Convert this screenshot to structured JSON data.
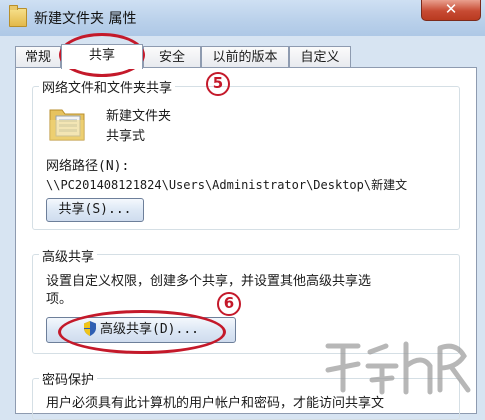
{
  "window": {
    "title": "新建文件夹 属性",
    "close_label": "✕"
  },
  "tabs": [
    {
      "label": "常规"
    },
    {
      "label": "共享"
    },
    {
      "label": "安全"
    },
    {
      "label": "以前的版本"
    },
    {
      "label": "自定义"
    }
  ],
  "network_share": {
    "group_title": "网络文件和文件夹共享",
    "folder_name": "新建文件夹",
    "share_state": "共享式",
    "path_label": "网络路径(N):",
    "path_value": "\\\\PC201408121824\\Users\\Administrator\\Desktop\\新建文",
    "share_button": "共享(S)..."
  },
  "advanced_share": {
    "group_title": "高级共享",
    "description": "设置自定义权限，创建多个共享，并设置其他高级共享选项。",
    "desc_line1": "设置自定义权限，创建多个共享，并设置其他高级共享选",
    "desc_line2": "项。",
    "button": "高级共享(D)..."
  },
  "password": {
    "group_title": "密码保护",
    "line1": "用户必须具有此计算机的用户帐户和密码，才能访问共享文"
  },
  "annotations": {
    "step5": "5",
    "step6": "6"
  },
  "colors": {
    "annotation_red": "#c4192a",
    "titlebar": "#b9d0ea"
  }
}
